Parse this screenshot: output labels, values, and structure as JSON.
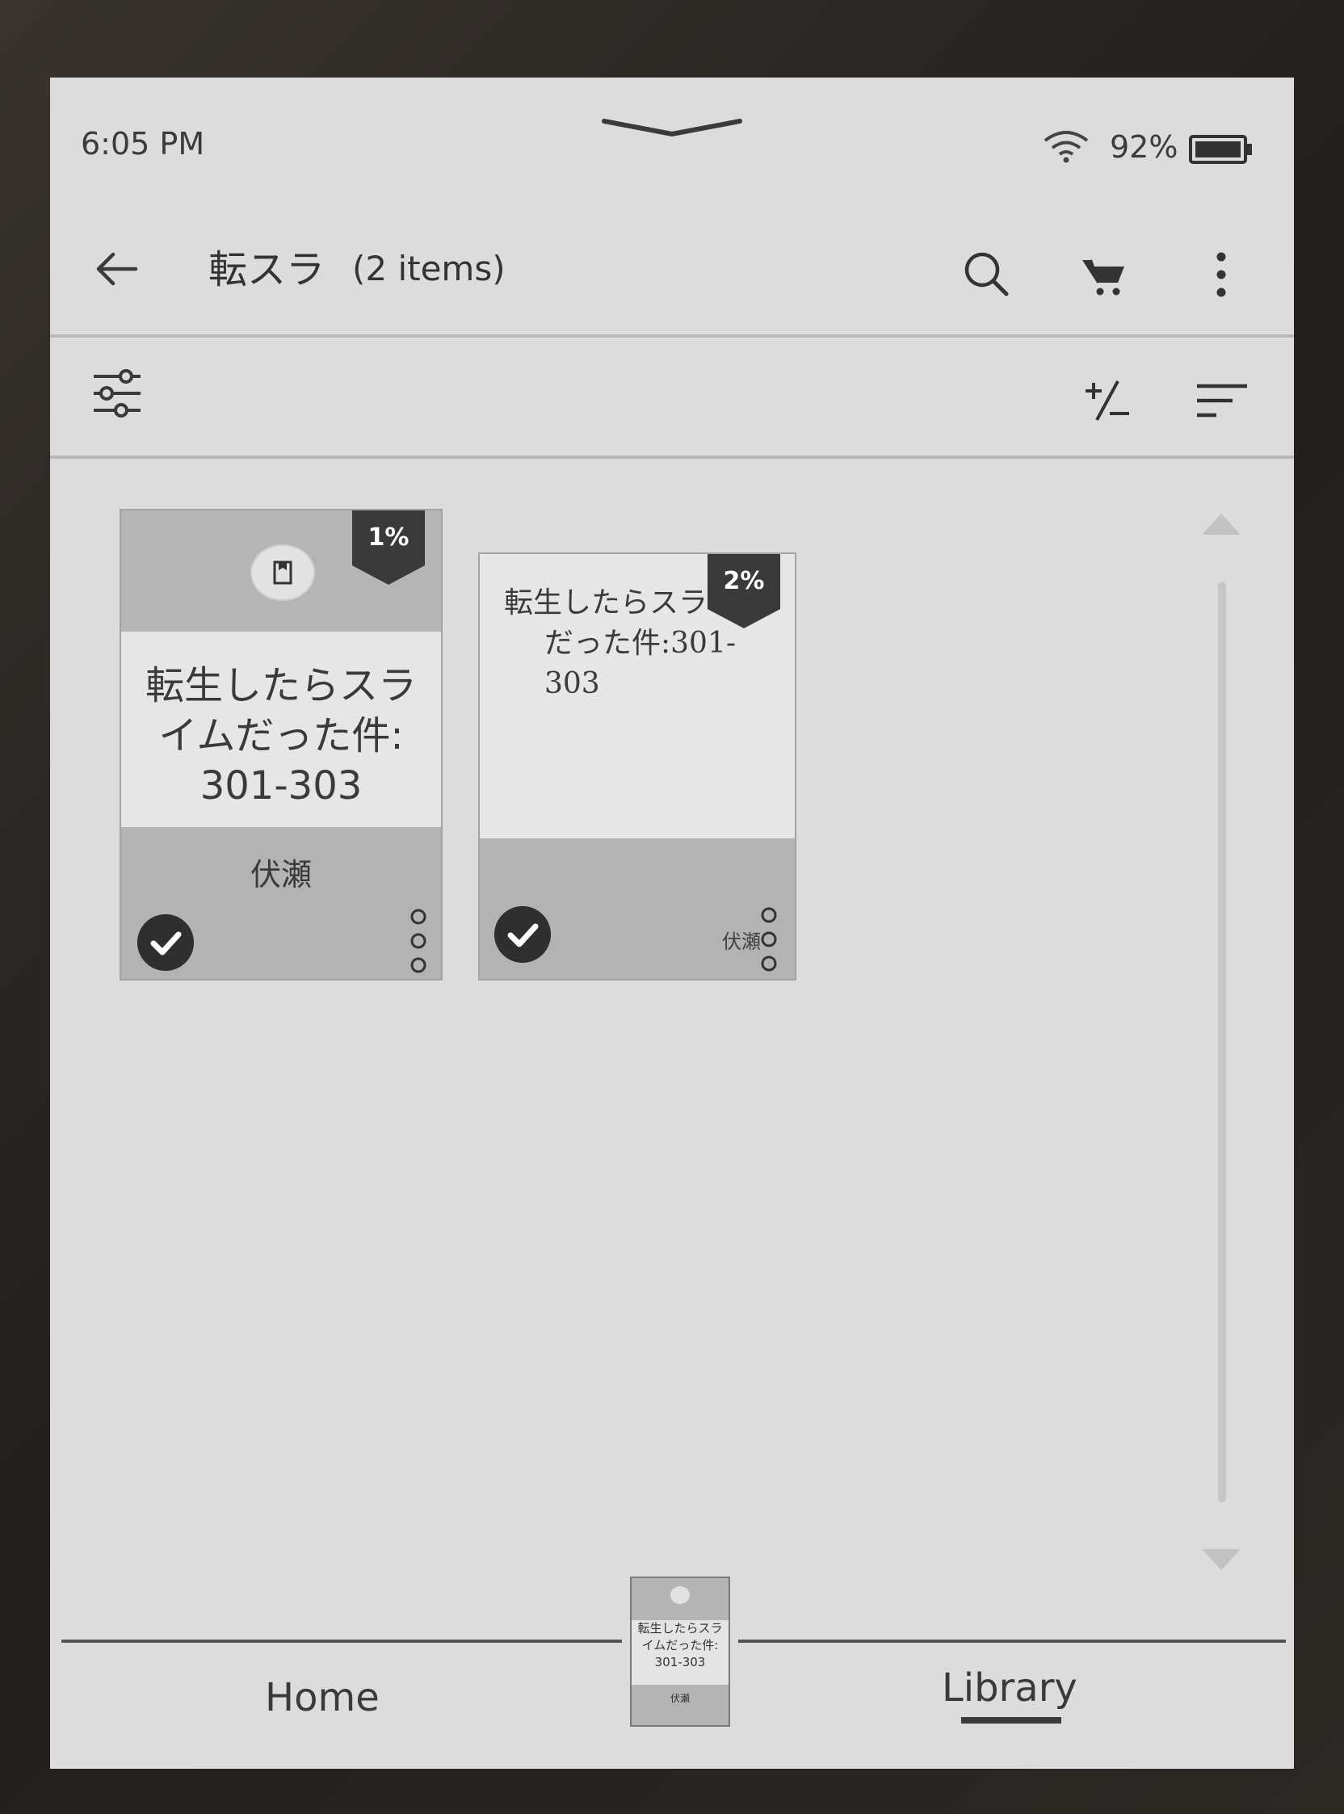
{
  "status_bar": {
    "time": "6:05 PM",
    "battery": "92%"
  },
  "header": {
    "title": "転スラ",
    "item_count": "(2 items)"
  },
  "books": [
    {
      "progress": "1%",
      "title_lines": [
        "転生したらスラ",
        "イムだった件:",
        "301-303"
      ],
      "author": "伏瀬"
    },
    {
      "progress": "2%",
      "title_lines": [
        "転生したらスラ",
        "だった件:301-303"
      ],
      "author": "伏瀬"
    }
  ],
  "bottom_nav": {
    "home": "Home",
    "library": "Library",
    "current_book": {
      "title_lines": [
        "転生したらスラ",
        "イムだった件:",
        "301-303"
      ],
      "author": "伏瀬"
    }
  }
}
